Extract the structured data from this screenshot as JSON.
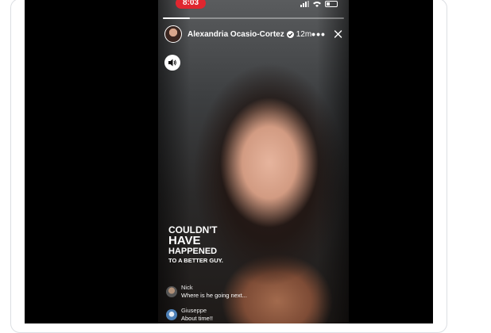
{
  "story": {
    "status_time": "8:03",
    "progress": 0.15,
    "author": "Alexandria Ocasio-Cortez",
    "timestamp": "12m",
    "caption": [
      "COULDN'T",
      "HAVE",
      "HAPPENED",
      "TO A BETTER GUY."
    ],
    "comments": [
      {
        "name": "Nick",
        "text": "Where is he going next..."
      },
      {
        "name": "Giuseppe",
        "text": "About time!!"
      }
    ]
  },
  "icons": {
    "verified": "verified-badge-icon",
    "more": "more-options-icon",
    "close": "close-icon",
    "sound": "speaker-icon"
  },
  "colors": {
    "status_pill": "#e0262f",
    "video_background": "#000000"
  }
}
